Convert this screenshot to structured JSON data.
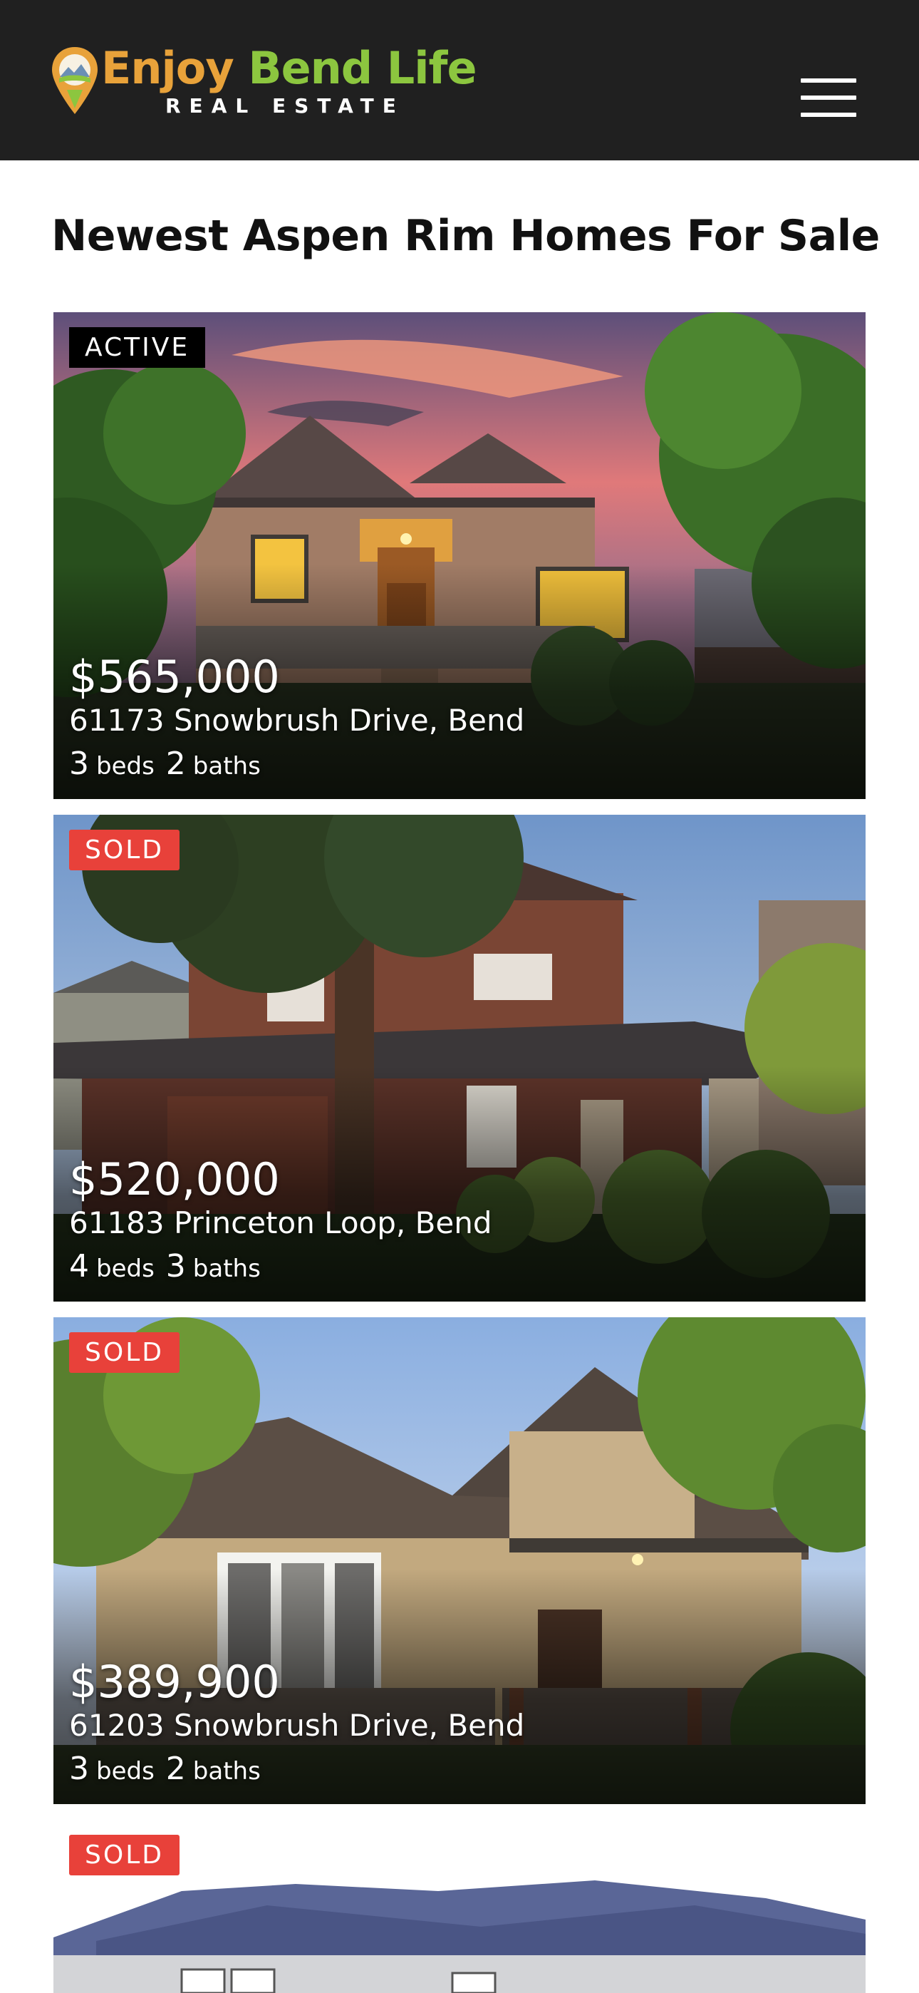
{
  "header": {
    "logo_word1": "Enjoy",
    "logo_word2": "Bend",
    "logo_word3": "Life",
    "logo_sub": "REAL ESTATE",
    "logo_icon": "map-pin-icon",
    "menu_icon": "hamburger-menu-icon",
    "colors": {
      "bg": "#202020",
      "orange": "#e8a23a",
      "green": "#8cc63f"
    }
  },
  "page": {
    "title": "Newest Aspen Rim Homes For Sale"
  },
  "listings": [
    {
      "status": "ACTIVE",
      "status_color": "#000000",
      "price": "$565,000",
      "address": "61173 Snowbrush Drive, Bend",
      "beds": "3",
      "beds_label": "beds",
      "baths": "2",
      "baths_label": "baths"
    },
    {
      "status": "SOLD",
      "status_color": "#e8413a",
      "price": "$520,000",
      "address": "61183 Princeton Loop, Bend",
      "beds": "4",
      "beds_label": "beds",
      "baths": "3",
      "baths_label": "baths"
    },
    {
      "status": "SOLD",
      "status_color": "#e8413a",
      "price": "$389,900",
      "address": "61203 Snowbrush Drive, Bend",
      "beds": "3",
      "beds_label": "beds",
      "baths": "2",
      "baths_label": "baths"
    },
    {
      "status": "SOLD",
      "status_color": "#e8413a"
    }
  ]
}
